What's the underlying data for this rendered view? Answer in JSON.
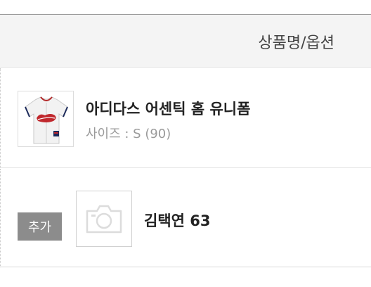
{
  "table": {
    "header_label": "상품명/옵션"
  },
  "product": {
    "name": "아디다스 어센틱 홈 유니폼",
    "option": "사이즈 : S (90)",
    "thumbnail_icon": "jersey-thumbnail"
  },
  "addon": {
    "badge": "추가",
    "name": "김택연 63",
    "placeholder_icon": "camera-icon"
  }
}
